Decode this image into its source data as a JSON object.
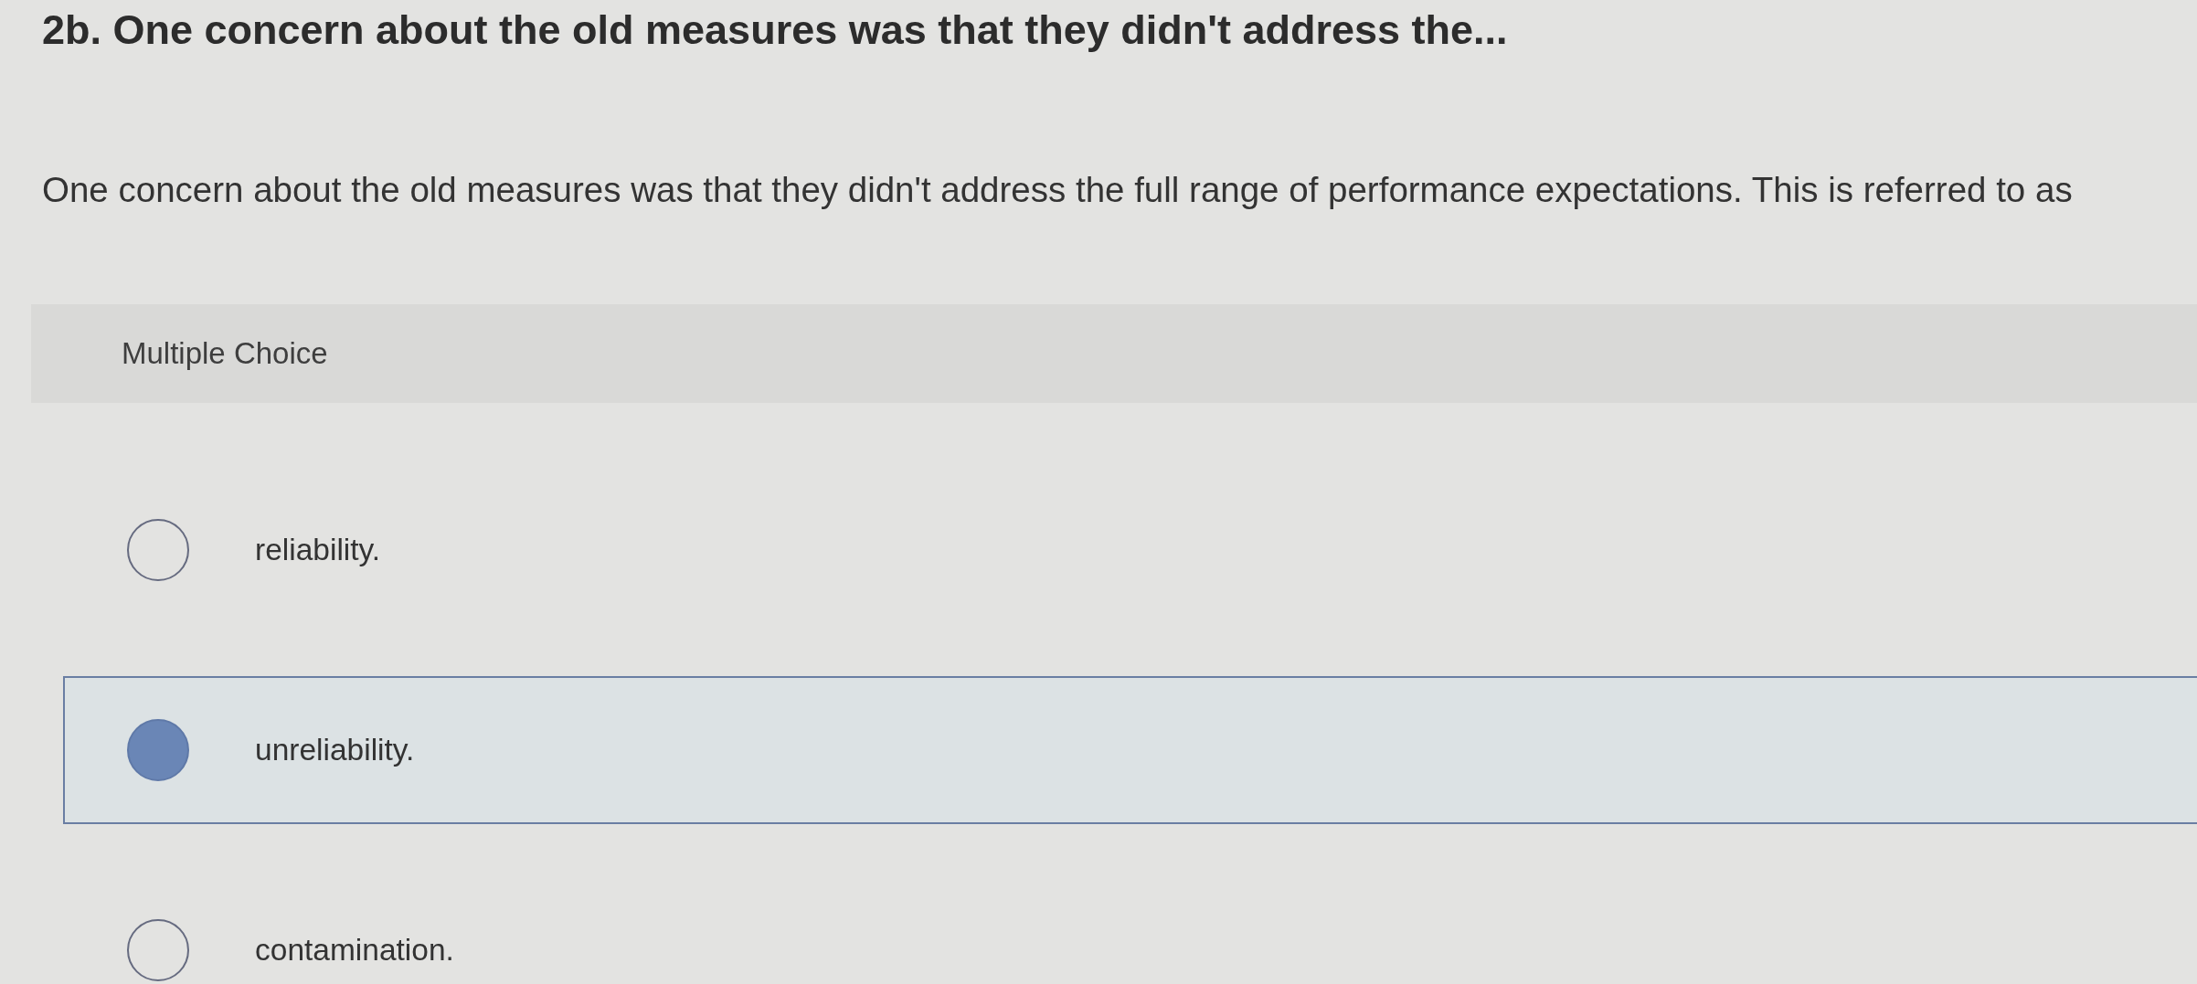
{
  "question": {
    "title": "2b. One concern about the old measures was that they didn't address the...",
    "prompt": "One concern about the old measures was that they didn't address the full range of performance expectations. This is referred to as"
  },
  "section_label": "Multiple Choice",
  "options": [
    {
      "label": "reliability.",
      "selected": false
    },
    {
      "label": "unreliability.",
      "selected": true
    },
    {
      "label": "contamination.",
      "selected": false
    }
  ]
}
